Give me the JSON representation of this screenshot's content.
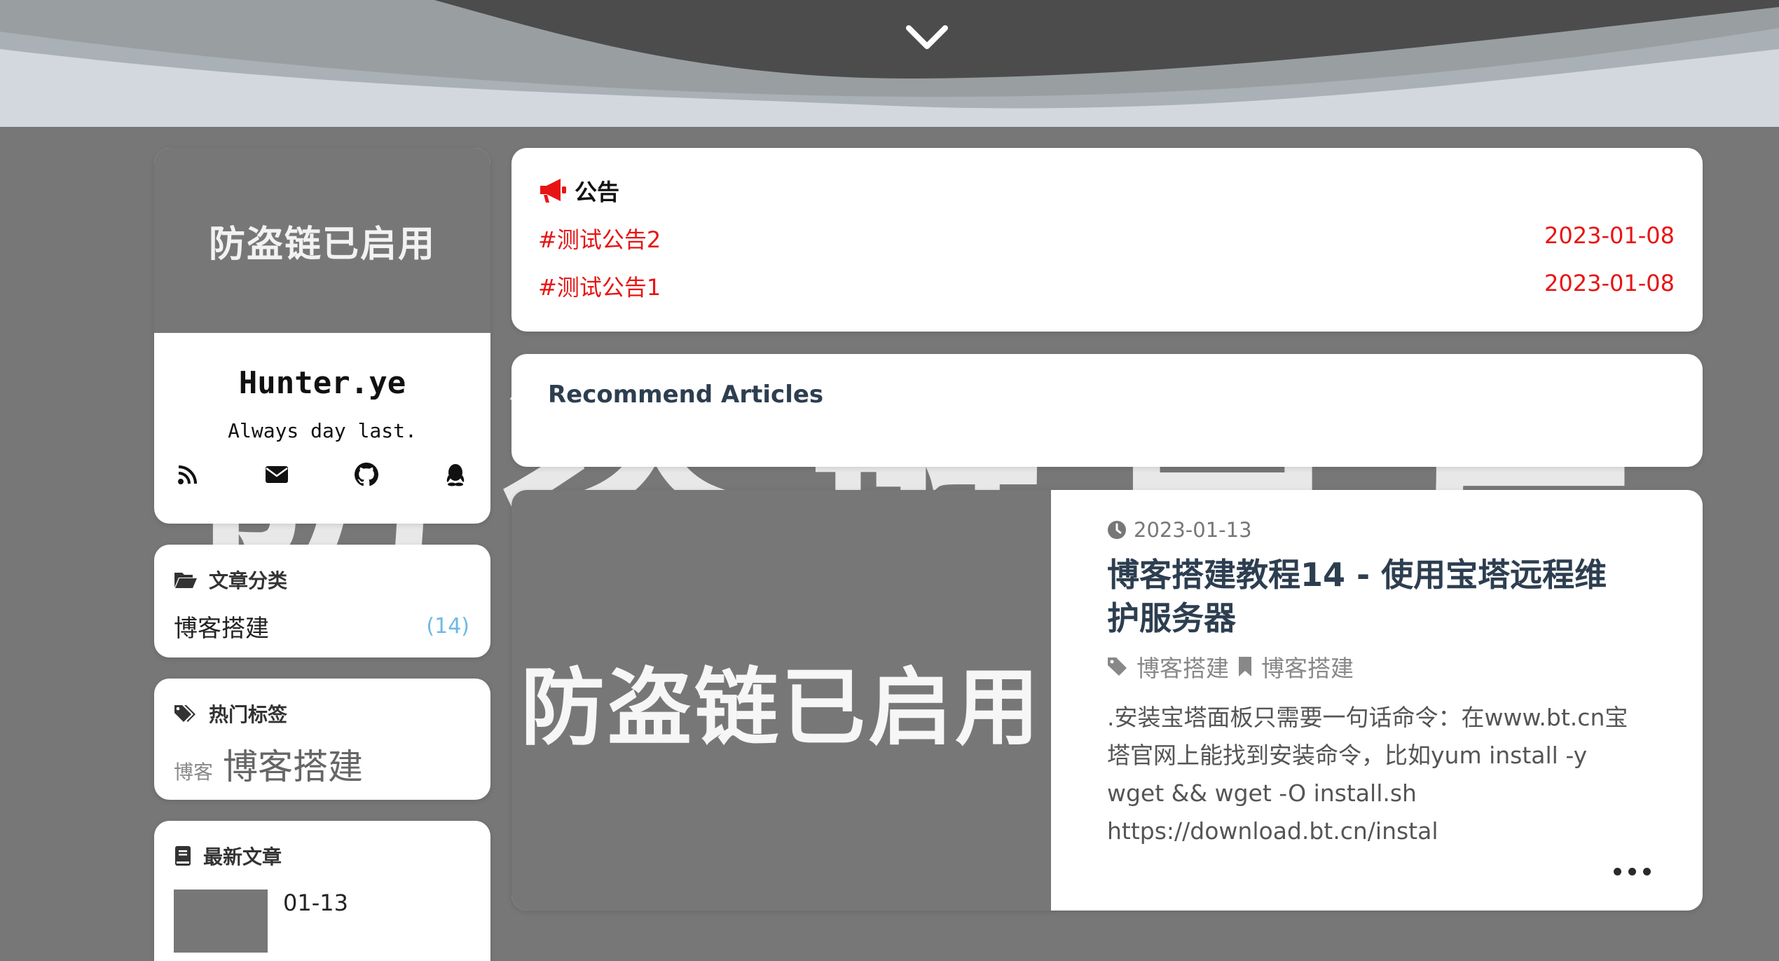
{
  "header": {
    "scroll_icon": "chevron-down-icon"
  },
  "watermark": "防盗链已启用",
  "profile": {
    "cover_text": "防盗链已启用",
    "name": "Hunter.ye",
    "motto": "Always day last.",
    "links": [
      {
        "icon": "rss-icon"
      },
      {
        "icon": "mail-icon"
      },
      {
        "icon": "github-icon"
      },
      {
        "icon": "qq-icon"
      }
    ]
  },
  "categories": {
    "title": "文章分类",
    "icon": "folder-open-icon",
    "items": [
      {
        "name": "博客搭建",
        "count": "(14)"
      }
    ]
  },
  "tags": {
    "title": "热门标签",
    "icon": "tags-icon",
    "items": [
      {
        "name": "博客"
      },
      {
        "name": "博客搭建"
      }
    ]
  },
  "recent": {
    "title": "最新文章",
    "icon": "book-icon",
    "items": [
      {
        "date": "01-13"
      }
    ]
  },
  "notice": {
    "title": "公告",
    "icon": "bullhorn-icon",
    "items": [
      {
        "text": "#测试公告2",
        "date": "2023-01-08"
      },
      {
        "text": "#测试公告1",
        "date": "2023-01-08"
      }
    ]
  },
  "recommend": {
    "title": "Recommend Articles"
  },
  "article": {
    "cover_text": "防盗链已启用",
    "date": "2023-01-13",
    "title": "博客搭建教程14 - 使用宝塔远程维护服务器",
    "tag": "博客搭建",
    "category": "博客搭建",
    "excerpt": ".安装宝塔面板只需要一句话命令：在www.bt.cn宝塔官网上能找到安装命令，比如yum install -y wget && wget -O install.sh https://download.bt.cn/instal"
  },
  "colors": {
    "accent_red": "#e81414",
    "count_blue": "#6cb9e6",
    "title_navy": "#2d3e50",
    "page_bg": "#777777"
  }
}
